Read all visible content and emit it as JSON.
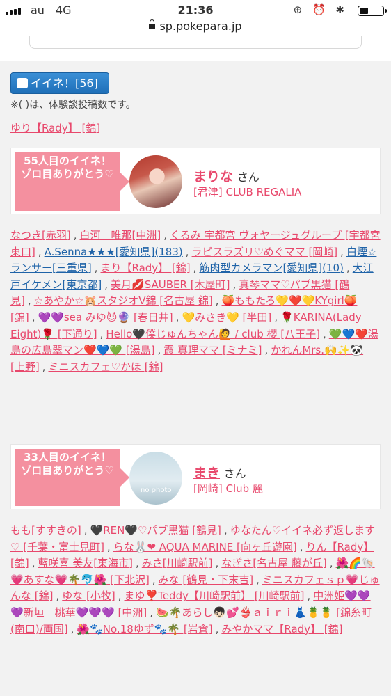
{
  "status": {
    "carrier": "au",
    "network": "4G",
    "time": "21:36",
    "icons": "⊕ ⏰ ✱"
  },
  "url": "sp.pokepara.jp",
  "iine": {
    "label": "イイネ！[56]",
    "note": "※( )は、体験談投稿数です。"
  },
  "first_link": "ゆり【Rady】 [錦]",
  "cards": [
    {
      "ribbon": "55人目のイイネ！\nゾロ目ありがとう♡",
      "name": "まりな",
      "suffix": "さん",
      "shop": "[君津] CLUB REGALIA"
    },
    {
      "ribbon": "33人目のイイネ！\nゾロ目ありがとう♡",
      "name": "まき",
      "suffix": "さん",
      "shop": "[岡崎] Club 麗",
      "avatar_text": "no photo"
    }
  ],
  "names1": [
    {
      "t": "なつき[赤羽]",
      "c": "pink"
    },
    {
      "t": "白河　唯那[中洲]",
      "c": "pink"
    },
    {
      "t": "くるみ 宇都宮 ヴォヤージュグループ [宇都宮東口]",
      "c": "pink"
    },
    {
      "t": "A.Senna★★★[愛知県](183)",
      "c": "blue"
    },
    {
      "t": "ラピスラズリ♡めぐママ [岡崎]",
      "c": "pink"
    },
    {
      "t": "白煙☆ランサー[三重県]",
      "c": "blue"
    },
    {
      "t": "まり【Rady】 [錦]",
      "c": "pink"
    },
    {
      "t": "筋肉型カメラマン[愛知県](10)",
      "c": "blue"
    },
    {
      "t": "大江戸イケメン[東京都]",
      "c": "blue"
    },
    {
      "t": "美月💋SAUBER [木屋町]",
      "c": "pink"
    },
    {
      "t": "真琴ママ♡パブ黒猫 [鶴見]",
      "c": "pink"
    },
    {
      "t": "☆あやか☆🐹スタジオV錦 [名古屋 錦]",
      "c": "pink"
    },
    {
      "t": "🍑ももたろ💛❤️💛KYgirl🍑 [錦]",
      "c": "pink"
    },
    {
      "t": "💜💜sea みゆ😈🔮 [春日井]",
      "c": "pink"
    },
    {
      "t": "💛みさき💛 [半田]",
      "c": "pink"
    },
    {
      "t": "🌹KARINA(Lady Eight)🌹 [下通り]",
      "c": "pink"
    },
    {
      "t": "Hello🖤僕じゅんちゃん🙋 / club 櫻 [八王子]",
      "c": "pink"
    },
    {
      "t": "💚💙❤️湯島の広島翠マン❤️💙💚 [湯島]",
      "c": "pink"
    },
    {
      "t": "霞 真理ママ [ミナミ]",
      "c": "pink"
    },
    {
      "t": "かれんMrs.🙌✨🐼 [上野]",
      "c": "pink"
    },
    {
      "t": "ミニスカフェ♡かほ [錦]",
      "c": "pink"
    }
  ],
  "names2": [
    {
      "t": "もも[すすきの]",
      "c": "pink"
    },
    {
      "t": "🖤REN🖤♡パブ黒猫 [鶴見]",
      "c": "pink"
    },
    {
      "t": "ゆなたん♡イイネ必ず返します♡ [千葉・富士見町]",
      "c": "pink"
    },
    {
      "t": "らな🐰❤ AQUA MARINE [向ヶ丘遊園]",
      "c": "pink"
    },
    {
      "t": "りん【Rady】 [錦]",
      "c": "pink"
    },
    {
      "t": "藍咲喜 美友[東海市]",
      "c": "pink"
    },
    {
      "t": "みさ[川崎駅前]",
      "c": "pink"
    },
    {
      "t": "なぎさ[名古屋 藤が丘]",
      "c": "pink"
    },
    {
      "t": "🌺🌈🐚💗あすな💗🌴🐬🌺 [下北沢]",
      "c": "pink"
    },
    {
      "t": "みな [鶴見・下末吉]",
      "c": "pink"
    },
    {
      "t": "ミニスカフェｓｐ💗じゅんな [錦]",
      "c": "pink"
    },
    {
      "t": "ゆな [小牧]",
      "c": "pink"
    },
    {
      "t": "まゆ❣️Teddy【川崎駅前】 [川崎駅前]",
      "c": "pink"
    },
    {
      "t": "中洲姫💜💜💜新垣　桃華💜💜💜 [中洲]",
      "c": "pink"
    },
    {
      "t": "🍉🌴あらし👦🏻💕👙ａｉｒｉ👗🍍🍍 [錦糸町(南口)/両国]",
      "c": "pink"
    },
    {
      "t": "🌺🐾No.18ゆず🐾🌴 [岩倉]",
      "c": "pink"
    },
    {
      "t": "みやかママ【Rady】 [錦]",
      "c": "pink"
    }
  ]
}
